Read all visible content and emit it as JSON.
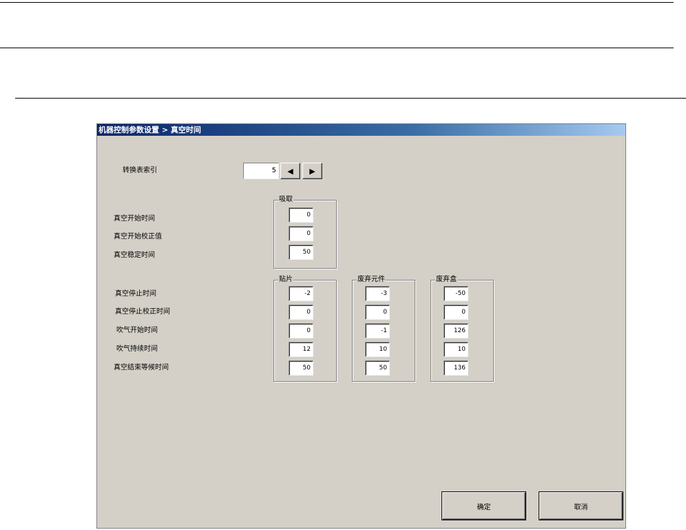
{
  "dialog": {
    "title": "机器控制参数设置 > 真空时间",
    "index": {
      "label": "转换表索引",
      "value": "5",
      "prev_icon": "left-arrow-icon",
      "next_icon": "right-arrow-icon"
    },
    "pickup": {
      "group_label": "吸取",
      "rows": [
        {
          "label": "真空开始时间",
          "value": "0"
        },
        {
          "label": "真空开始校正值",
          "value": "0"
        },
        {
          "label": "真空稳定时间",
          "value": "50"
        }
      ]
    },
    "place": {
      "group_labels": [
        "贴片",
        "废弃元件",
        "废弃盒"
      ],
      "rows": [
        {
          "label": "真空停止时间",
          "values": [
            "-2",
            "-3",
            "-50"
          ]
        },
        {
          "label": "真空停止校正时间",
          "values": [
            "0",
            "0",
            "0"
          ]
        },
        {
          "label": "吹气开始时间",
          "values": [
            "0",
            "-1",
            "126"
          ]
        },
        {
          "label": "吹气持续时间",
          "values": [
            "12",
            "10",
            "10"
          ]
        },
        {
          "label": "真空结束等候时间",
          "values": [
            "50",
            "50",
            "136"
          ]
        }
      ]
    },
    "buttons": {
      "ok": "确定",
      "cancel": "取消"
    }
  }
}
